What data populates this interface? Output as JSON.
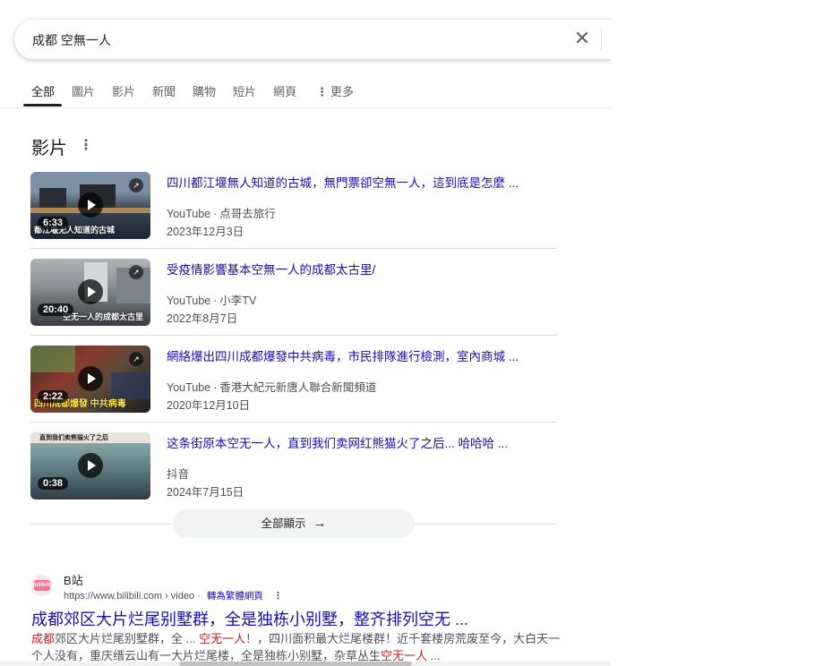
{
  "search": {
    "query": "成都 空無一人",
    "clear_icon": "close-icon"
  },
  "tabs": [
    {
      "label": "全部",
      "active": true
    },
    {
      "label": "圖片"
    },
    {
      "label": "影片"
    },
    {
      "label": "新聞"
    },
    {
      "label": "購物"
    },
    {
      "label": "短片"
    },
    {
      "label": "網頁"
    },
    {
      "label": "更多",
      "icon": "more-vert-icon"
    }
  ],
  "videos_section": {
    "title": "影片",
    "items": [
      {
        "title": "四川都江堰無人知道的古城，無門票卻空無一人，這到底是怎麼 ...",
        "platform": "YouTube",
        "channel": "点哥去旅行",
        "date": "2023年12月3日",
        "duration": "6:33",
        "overlay": "都江堰无人知道的古城",
        "colors": {
          "a": "#7d8fa3",
          "b": "#3c4652",
          "c": "#1a2533"
        }
      },
      {
        "title": "受疫情影響基本空無一人的成都太古里/",
        "platform": "YouTube",
        "channel": "小李TV",
        "date": "2022年8月7日",
        "duration": "20:40",
        "overlay": "空无一人的成都太古里",
        "colors": {
          "a": "#b0b4b8",
          "b": "#6d7277",
          "c": "#3a3e42"
        }
      },
      {
        "title": "網絡爆出四川成都爆發中共病毒，市民排隊進行檢測，室內商城 ...",
        "platform": "YouTube",
        "channel": "香港大紀元新唐人聯合新聞頻道",
        "date": "2020年12月10日",
        "duration": "2:22",
        "overlay": "四川成都爆發 中共病毒",
        "colors": {
          "a": "#3a2a26",
          "b": "#8a3a2c",
          "c": "#1c1c22"
        }
      },
      {
        "title": "这条街原本空无一人，直到我们卖网红熊猫火了之后... 哈哈哈 ...",
        "platform": "",
        "channel": "抖音",
        "date": "2024年7月15日",
        "duration": "0:38",
        "overlay": "直到我们卖熊猫火了之后",
        "colors": {
          "a": "#9ab6b8",
          "b": "#5e7c82",
          "c": "#2f3d44"
        }
      }
    ],
    "show_all_label": "全部顯示",
    "show_all_icon": "arrow-right-icon"
  },
  "result": {
    "site_name": "B站",
    "favicon_text": "bilibili",
    "url": "https://www.bilibili.com › video",
    "translate_label": "轉為繁體網頁",
    "title": "成都郊区大片烂尾别墅群，全是独栋小别墅，整齐排列空无 ...",
    "snippet_parts": [
      {
        "text": "成都",
        "hl": true
      },
      {
        "text": "郊区大片烂尾别墅群，全 ... ",
        "hl": false
      },
      {
        "text": "空无一人",
        "hl": true
      },
      {
        "text": "！，四川面积最大烂尾楼群！近千套楼房荒废至今，大白天一个人没有，重庆缙云山有一大片烂尾楼，全是独栋小别墅，杂草丛生",
        "hl": false
      },
      {
        "text": "空无一人",
        "hl": true
      },
      {
        "text": " ...",
        "hl": false
      }
    ]
  }
}
